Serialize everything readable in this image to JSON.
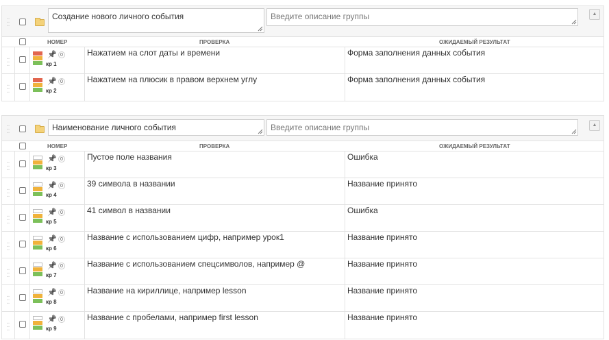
{
  "colors": {
    "red": "#e2664f",
    "orange": "#f0b23b",
    "green": "#7cc05a",
    "white": "#ffffff"
  },
  "icons": {
    "drag": "drag-handle-icon",
    "folder": "folder-icon",
    "pin": "pin-icon",
    "collapse": "collapse-up-icon"
  },
  "headers": {
    "number": "НОМЕР",
    "check": "ПРОВЕРКА",
    "expected": "ОЖИДАЕМЫЙ РЕЗУЛЬТАТ"
  },
  "collapse_glyph": "▲",
  "groups": [
    {
      "name": "Создание нового личного события",
      "description_placeholder": "Введите описание группы",
      "rows": [
        {
          "id": "кр 1",
          "count": "0",
          "bars": [
            "red",
            "orange",
            "green"
          ],
          "check": "Нажатием на слот даты и времени",
          "expected": "Форма заполнения данных события"
        },
        {
          "id": "кр 2",
          "count": "0",
          "bars": [
            "red",
            "orange",
            "green"
          ],
          "check": "Нажатием на плюсик в правом верхнем углу",
          "expected": "Форма заполнения данных события"
        }
      ]
    },
    {
      "name": "Наименование личного события",
      "description_placeholder": "Введите описание группы",
      "rows": [
        {
          "id": "кр 3",
          "count": "0",
          "bars": [
            "white",
            "orange",
            "green"
          ],
          "check": "Пустое поле названия",
          "expected": "Ошибка"
        },
        {
          "id": "кр 4",
          "count": "0",
          "bars": [
            "white",
            "orange",
            "green"
          ],
          "check": "39 символа в названии",
          "expected": "Название принято"
        },
        {
          "id": "кр 5",
          "count": "0",
          "bars": [
            "white",
            "orange",
            "green"
          ],
          "check": "41 символ в названии",
          "expected": "Ошибка"
        },
        {
          "id": "кр 6",
          "count": "0",
          "bars": [
            "white",
            "orange",
            "green"
          ],
          "check": "Название с использованием цифр, например урок1",
          "expected": "Название принято"
        },
        {
          "id": "кр 7",
          "count": "0",
          "bars": [
            "white",
            "orange",
            "green"
          ],
          "check": "Название с использованием спецсимволов, например @",
          "expected": "Название принято"
        },
        {
          "id": "кр 8",
          "count": "0",
          "bars": [
            "white",
            "orange",
            "green"
          ],
          "check": "Название на кириллице, например lesson",
          "expected": "Название принято"
        },
        {
          "id": "кр 9",
          "count": "0",
          "bars": [
            "white",
            "orange",
            "green"
          ],
          "check": "Название с пробелами, например first lesson",
          "expected": "Название принято"
        }
      ]
    }
  ]
}
